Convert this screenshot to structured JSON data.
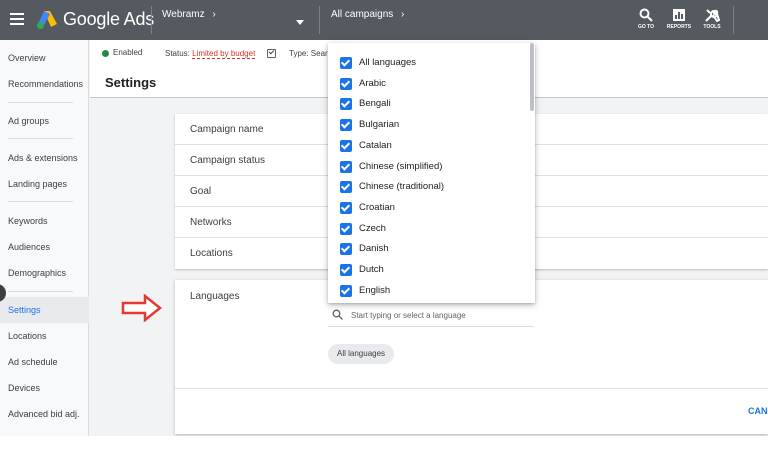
{
  "topbar": {
    "brand": "Google Ads",
    "account": "Webramz",
    "campaign": "All campaigns",
    "tools": [
      {
        "label": "GO TO",
        "icon": "search-icon"
      },
      {
        "label": "REPORTS",
        "icon": "reports-icon"
      },
      {
        "label": "TOOLS",
        "icon": "wrench-icon"
      }
    ]
  },
  "sidebar": {
    "items": [
      "Overview",
      "Recommendations",
      "Ad groups",
      "Ads & extensions",
      "Landing pages",
      "Keywords",
      "Audiences",
      "Demographics",
      "Settings",
      "Locations",
      "Ad schedule",
      "Devices",
      "Advanced bid adj."
    ],
    "active": "Settings"
  },
  "status_row": {
    "enabled": "Enabled",
    "status_prefix": "Status:",
    "status_value": "Limited by budget",
    "type": "Type: Sear"
  },
  "page": {
    "title": "Settings"
  },
  "settings_rows": [
    "Campaign name",
    "Campaign status",
    "Goal",
    "Networks",
    "Locations"
  ],
  "languages_section": {
    "label": "Languages",
    "search_placeholder": "Start typing or select a language",
    "chip": "All languages",
    "cancel": "CANC"
  },
  "dropdown": {
    "options": [
      {
        "label": "All languages",
        "checked": true
      },
      {
        "label": "Arabic",
        "checked": true
      },
      {
        "label": "Bengali",
        "checked": true
      },
      {
        "label": "Bulgarian",
        "checked": true
      },
      {
        "label": "Catalan",
        "checked": true
      },
      {
        "label": "Chinese (simplified)",
        "checked": true
      },
      {
        "label": "Chinese (traditional)",
        "checked": true
      },
      {
        "label": "Croatian",
        "checked": true
      },
      {
        "label": "Czech",
        "checked": true
      },
      {
        "label": "Danish",
        "checked": true
      },
      {
        "label": "Dutch",
        "checked": true
      },
      {
        "label": "English",
        "checked": true
      }
    ]
  },
  "colors": {
    "topbar": "#545a5f",
    "accent": "#1a73e8",
    "warning": "#d93025",
    "enabled_dot": "#1e8e3e",
    "arrow": "#e53935"
  }
}
